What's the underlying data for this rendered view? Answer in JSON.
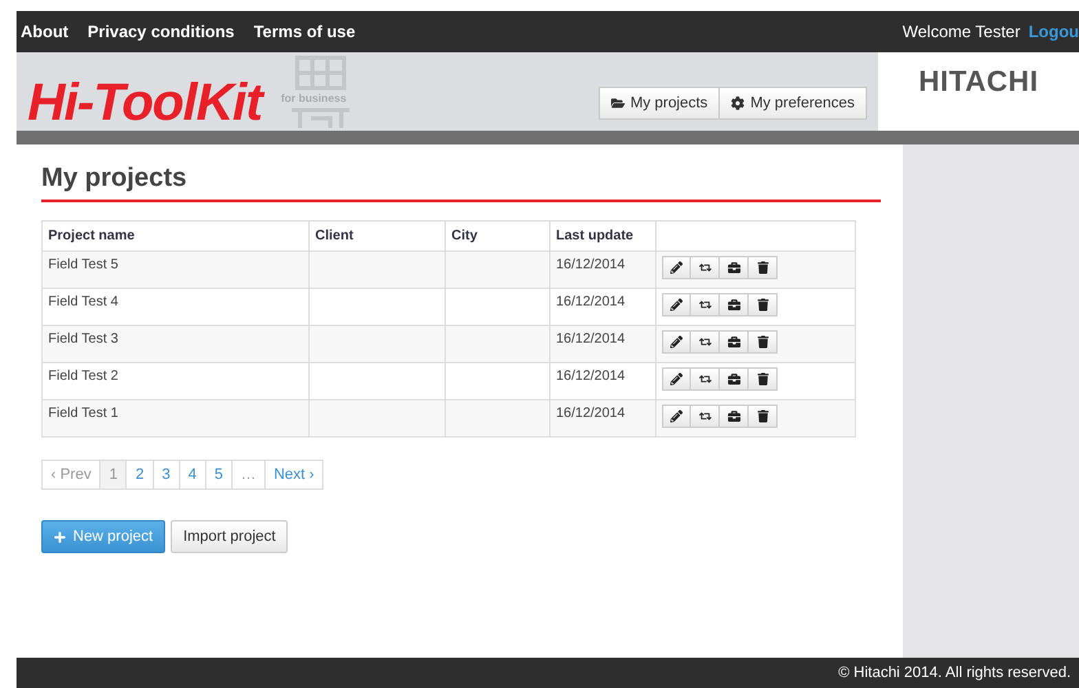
{
  "top_bar": {
    "links": [
      "About",
      "Privacy conditions",
      "Terms of use"
    ],
    "welcome": "Welcome Tester",
    "logout": "Logou"
  },
  "header": {
    "logo": "Hi-ToolKit",
    "logo_badge": "for business",
    "nav": [
      {
        "label": "My projects",
        "selected": false
      },
      {
        "label": "My preferences",
        "selected": false
      }
    ],
    "brand": "HITACHI"
  },
  "page_title": "My projects",
  "table": {
    "columns": [
      "Project name",
      "Client",
      "City",
      "Last update"
    ],
    "rows": [
      {
        "name": "Field Test 5",
        "date": "16/12/2014"
      },
      {
        "name": "Field Test 4",
        "date": "16/12/2014"
      },
      {
        "name": "Field Test 3",
        "date": "16/12/2014"
      },
      {
        "name": "Field Test 2",
        "date": "16/12/2014"
      },
      {
        "name": "Field Test 1",
        "date": "16/12/2014"
      }
    ]
  },
  "pagination": [
    {
      "label": "‹ Prev",
      "disabled": true,
      "selected": false
    },
    {
      "label": "1",
      "disabled": false,
      "selected": true
    },
    {
      "label": "2",
      "disabled": false,
      "selected": false
    },
    {
      "label": "3",
      "disabled": false,
      "selected": false
    },
    {
      "label": "4",
      "disabled": false,
      "selected": false
    },
    {
      "label": "5",
      "disabled": false,
      "selected": false
    },
    {
      "label": "…",
      "disabled": true,
      "selected": false
    },
    {
      "label": "Next ›",
      "disabled": false,
      "selected": false
    }
  ],
  "buttons": [
    {
      "label": "New project",
      "kind": "primary"
    },
    {
      "label": "Import project",
      "kind": "default"
    }
  ],
  "footer": "© Hitachi 2014. All rights reserved."
}
